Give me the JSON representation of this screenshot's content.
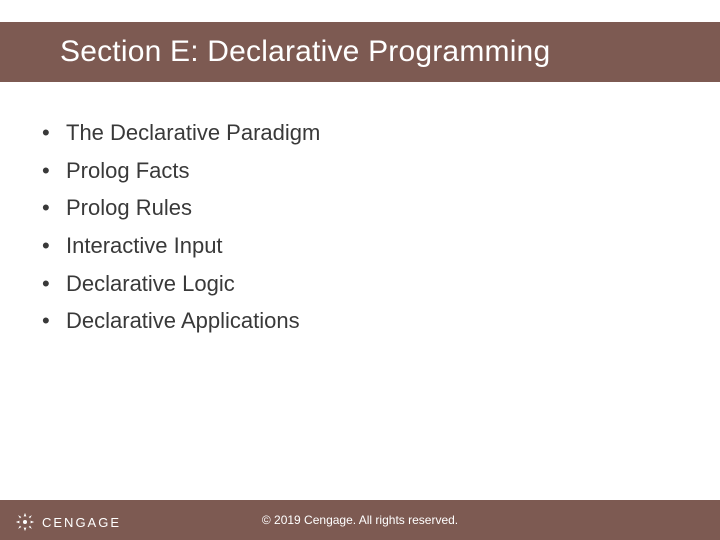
{
  "title": "Section E: Declarative Programming",
  "bullets": [
    "The Declarative Paradigm",
    "Prolog Facts",
    "Prolog Rules",
    "Interactive Input",
    "Declarative Logic",
    "Declarative Applications"
  ],
  "footer": "© 2019 Cengage. All rights reserved.",
  "brand": "CENGAGE",
  "colors": {
    "band": "#7d5a52",
    "text": "#393939"
  }
}
